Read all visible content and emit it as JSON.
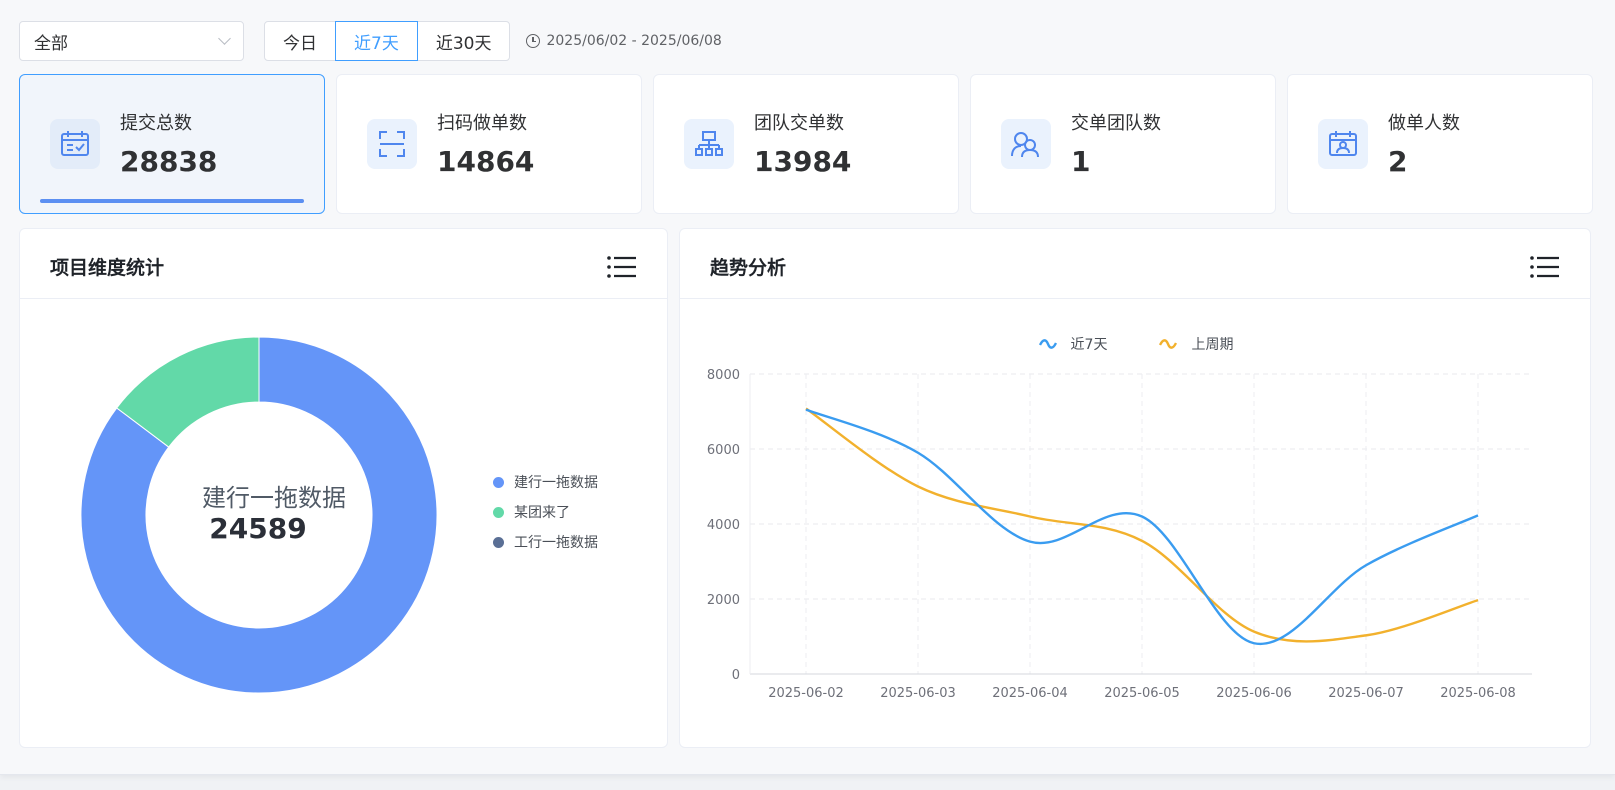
{
  "filters": {
    "scope_select": "全部",
    "range_options": [
      "今日",
      "近7天",
      "近30天"
    ],
    "active_range": "近7天",
    "date_range": "2025/06/02 - 2025/06/08"
  },
  "stats": [
    {
      "label": "提交总数",
      "value": "28838",
      "icon": "calendar-check-icon",
      "active": true
    },
    {
      "label": "扫码做单数",
      "value": "14864",
      "icon": "scan-icon",
      "active": false
    },
    {
      "label": "团队交单数",
      "value": "13984",
      "icon": "org-chart-icon",
      "active": false
    },
    {
      "label": "交单团队数",
      "value": "1",
      "icon": "team-users-icon",
      "active": false
    },
    {
      "label": "做单人数",
      "value": "2",
      "icon": "calendar-user-icon",
      "active": false
    }
  ],
  "colors": {
    "accent": "#409eff",
    "series_blue": "#3a9cf0",
    "series_orange": "#f2b12d",
    "pie_blue": "#6495f8",
    "pie_green": "#62d9a8",
    "pie_slate": "#5a6f95"
  },
  "project_panel": {
    "title": "项目维度统计",
    "center_label": "建行一拖数据",
    "center_value": "24589",
    "legend": [
      "建行一拖数据",
      "某团来了",
      "工行一拖数据"
    ]
  },
  "trend_panel": {
    "title": "趋势分析",
    "legend": [
      "近7天",
      "上周期"
    ]
  },
  "chart_data": [
    {
      "type": "pie",
      "donut": true,
      "labels": [
        "建行一拖数据",
        "某团来了",
        "工行一拖数据"
      ],
      "values": [
        24589,
        4249,
        0
      ]
    },
    {
      "type": "line",
      "smooth": true,
      "x": [
        "2025-06-02",
        "2025-06-03",
        "2025-06-04",
        "2025-06-05",
        "2025-06-06",
        "2025-06-07",
        "2025-06-08"
      ],
      "series": [
        {
          "name": "近7天",
          "values": [
            7050,
            5900,
            3530,
            4200,
            820,
            2900,
            4230
          ]
        },
        {
          "name": "上周期",
          "values": [
            7080,
            5000,
            4200,
            3550,
            1130,
            1030,
            1970
          ]
        }
      ],
      "ylim": [
        0,
        8000
      ],
      "yticks": [
        0,
        2000,
        4000,
        6000,
        8000
      ],
      "grid": true,
      "legend_position": "top-center"
    }
  ]
}
